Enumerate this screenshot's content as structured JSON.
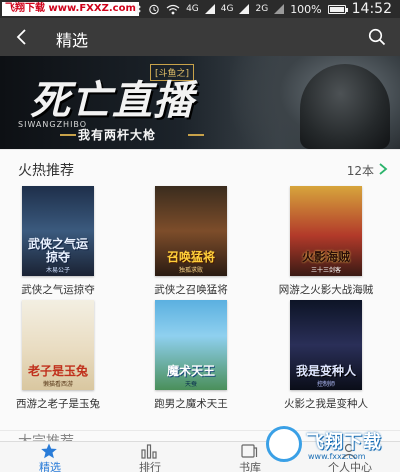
{
  "status_bar": {
    "watermark": "飞翔下载 www.FXXZ.com",
    "network": "4G",
    "network2": "4G",
    "network3": "2G",
    "battery": "100%",
    "time": "14:52"
  },
  "header": {
    "title": "精选"
  },
  "banner": {
    "tag": "[斗鱼之]",
    "title": "死亡直播",
    "pinyin": "SIWANGZHIBO",
    "slogan": "我有两杆大枪"
  },
  "hot": {
    "title": "火热推荐",
    "more": "12本",
    "books": [
      {
        "title": "武侠之气运掠夺",
        "cover_title": "武侠之气运掠夺",
        "cover_author": "木易公子"
      },
      {
        "title": "武侠之召唤猛将",
        "cover_title": "召唤猛将",
        "cover_author": "独孤求败"
      },
      {
        "title": "网游之火影大战海贼",
        "cover_title": "火影海贼",
        "cover_author": "三十三剑客"
      },
      {
        "title": "西游之老子是玉兔",
        "cover_title": "老子是玉兔",
        "cover_author": "懒猫看西游"
      },
      {
        "title": "跑男之魔术天王",
        "cover_title": "魔术天王",
        "cover_author": "天蚕"
      },
      {
        "title": "火影之我是变种人",
        "cover_title": "我是变种人",
        "cover_author": "控制师"
      }
    ]
  },
  "next_section": {
    "title": "大宗推荐"
  },
  "bottom_nav": [
    {
      "label": "精选",
      "icon": "star-icon",
      "active": true
    },
    {
      "label": "排行",
      "icon": "bar-chart-icon",
      "active": false
    },
    {
      "label": "书库",
      "icon": "book-icon",
      "active": false
    },
    {
      "label": "个人中心",
      "icon": "person-icon",
      "active": false
    }
  ],
  "watermark_bottom": {
    "text": "飞翔下载",
    "url": "www.fxxz.com"
  },
  "colors": {
    "status_bar": "#2b2b2b",
    "header": "#3a3a3a",
    "accent": "#2a7cd8",
    "more_arrow": "#2bb36b"
  }
}
